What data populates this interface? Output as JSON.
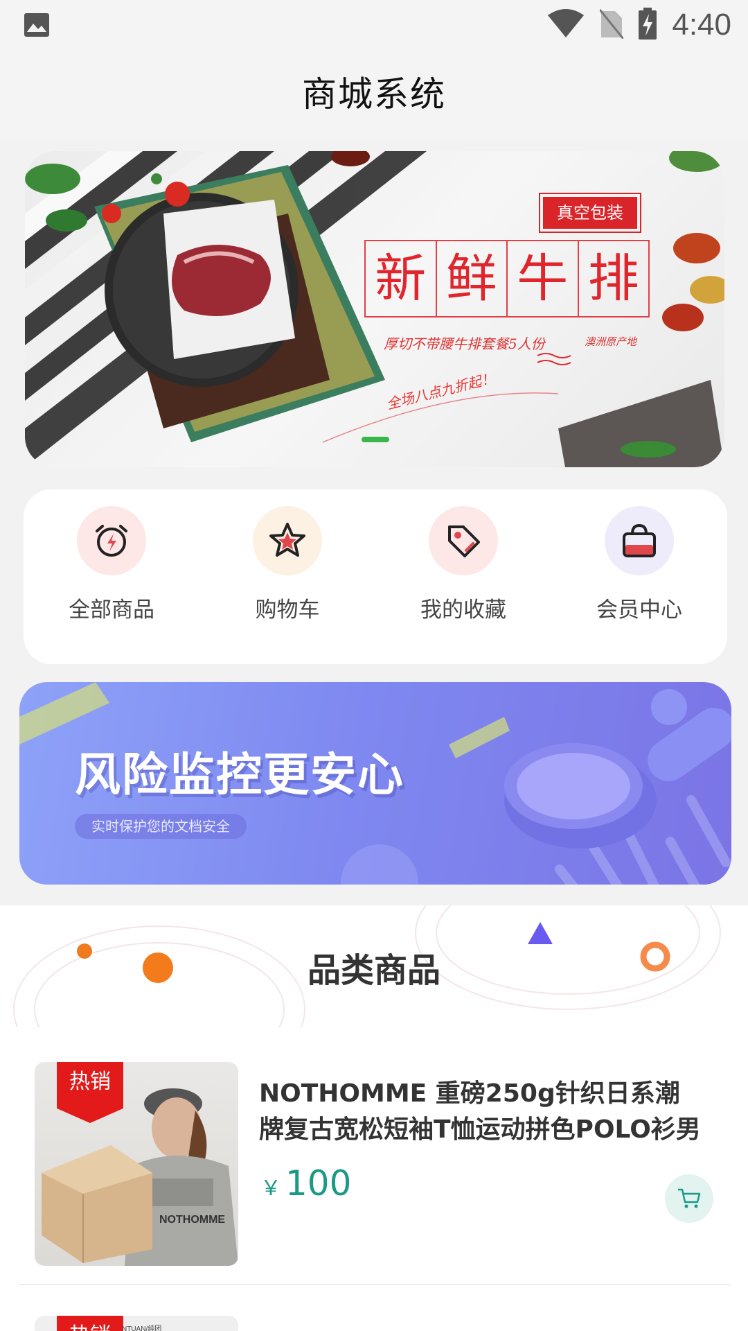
{
  "status_bar": {
    "time": "4:40"
  },
  "header": {
    "title": "商城系统"
  },
  "banner_main": {
    "tag": "真空包装",
    "headline_chars": [
      "新",
      "鲜",
      "牛",
      "排"
    ],
    "subtitle": "厚切不带腰牛排套餐5人份",
    "origin": "澳洲原产地",
    "promo": "全场八点九折起！",
    "indicator_color": "#3ab54a"
  },
  "quick_menu": [
    {
      "label": "全部商品",
      "icon": "alarm-clock-icon",
      "bg": "#fde7e7"
    },
    {
      "label": "购物车",
      "icon": "star-icon",
      "bg": "#fdf1e4"
    },
    {
      "label": "我的收藏",
      "icon": "tag-icon",
      "bg": "#fde7e7"
    },
    {
      "label": "会员中心",
      "icon": "shopping-bag-icon",
      "bg": "#eeebfb"
    }
  ],
  "banner_secondary": {
    "title": "风险监控更安心",
    "subtitle": "实时保护您的文档安全"
  },
  "section": {
    "title": "品类商品"
  },
  "products": [
    {
      "badge": "热销",
      "name": "NOTHOMME 重磅250g针织日系潮牌复古宽松短袖T恤运动拼色POLO衫男",
      "currency": "￥",
      "price": "100",
      "shirt_print": "NOTHOMME"
    },
    {
      "badge": "热销",
      "brand_text": "NTUAN/纯团"
    }
  ],
  "colors": {
    "accent_green": "#1a9a86",
    "hot_red": "#e31a1a"
  }
}
